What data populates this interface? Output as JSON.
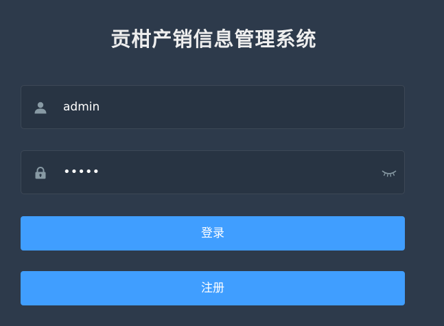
{
  "title": "贡柑产销信息管理系统",
  "username": {
    "icon": "user-icon",
    "value": "admin"
  },
  "password": {
    "icon": "lock-icon",
    "masked_value": "•••••",
    "toggle_icon": "eye-closed-icon"
  },
  "buttons": {
    "login_label": "登录",
    "register_label": "注册"
  },
  "colors": {
    "background": "#2d3a4b",
    "field_background": "#283443",
    "primary": "#409eff",
    "icon": "#889aa4"
  }
}
